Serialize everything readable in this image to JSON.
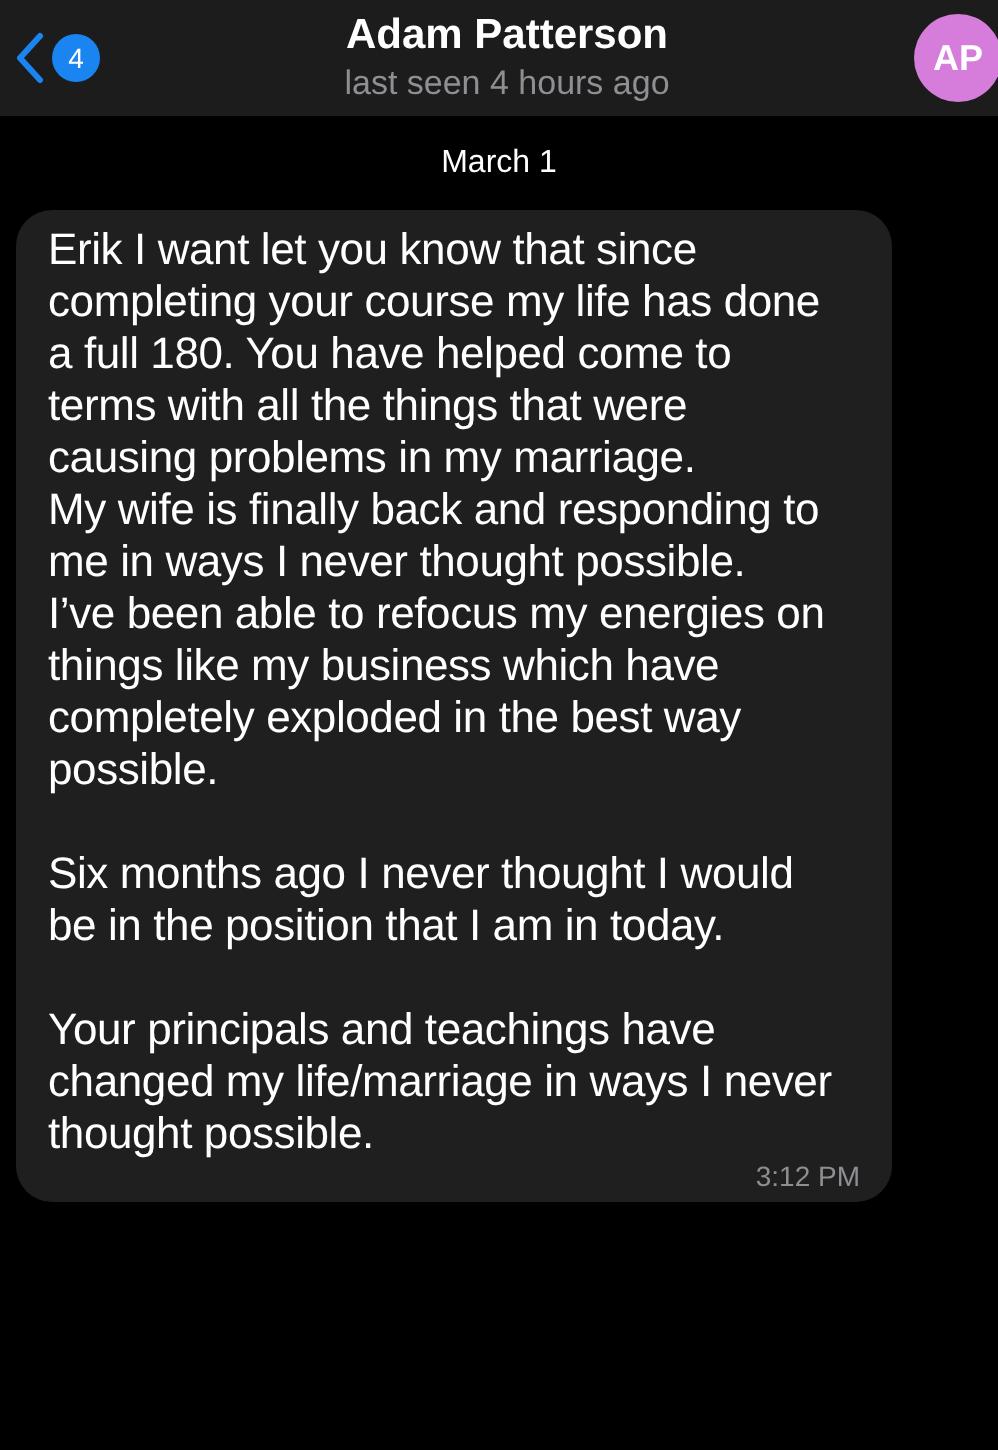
{
  "header": {
    "back_badge": "4",
    "name": "Adam Patterson",
    "status": "last seen 4 hours ago",
    "avatar": {
      "initials": "AP",
      "color": "#d67ddc"
    }
  },
  "date_label": "March 1",
  "message": {
    "paragraphs": [
      [
        "Erik I want let you know that since",
        "completing your course my life has done",
        "a full 180. You have helped come to",
        "terms with all the things that were",
        "causing problems in my marriage.",
        "My wife is finally back and responding to",
        "me in ways I never thought possible.",
        "I’ve been able to refocus my energies on",
        "things like my business which have",
        "completely exploded in the best way",
        "possible."
      ],
      [
        "Six months ago I never thought I would",
        "be in the position that I am in today."
      ],
      [
        "Your principals and teachings have",
        "changed my life/marriage in ways I never",
        "thought possible."
      ]
    ],
    "time": "3:12 PM"
  }
}
